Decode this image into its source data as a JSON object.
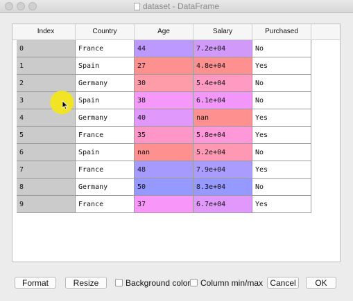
{
  "window": {
    "title": "dataset - DataFrame"
  },
  "table": {
    "headers": [
      "Index",
      "Country",
      "Age",
      "Salary",
      "Purchased"
    ],
    "rows": [
      {
        "index": "0",
        "country": "France",
        "age": "44",
        "salary": "7.2e+04",
        "purchased": "No",
        "age_color": "#bb99ff",
        "salary_color": "#d199fa"
      },
      {
        "index": "1",
        "country": "Spain",
        "age": "27",
        "salary": "4.8e+04",
        "purchased": "Yes",
        "age_color": "#ff9090",
        "salary_color": "#ff9090"
      },
      {
        "index": "2",
        "country": "Germany",
        "age": "30",
        "salary": "5.4e+04",
        "purchased": "No",
        "age_color": "#ff9caa",
        "salary_color": "#ff9ac2"
      },
      {
        "index": "3",
        "country": "Spain",
        "age": "38",
        "salary": "6.1e+04",
        "purchased": "No",
        "age_color": "#f598fa",
        "salary_color": "#f396fa"
      },
      {
        "index": "4",
        "country": "Germany",
        "age": "40",
        "salary": "nan",
        "purchased": "Yes",
        "age_color": "#e099fa",
        "salary_color": "#ff9090"
      },
      {
        "index": "5",
        "country": "France",
        "age": "35",
        "salary": "5.8e+04",
        "purchased": "Yes",
        "age_color": "#ff96c8",
        "salary_color": "#ff98d8"
      },
      {
        "index": "6",
        "country": "Spain",
        "age": "nan",
        "salary": "5.2e+04",
        "purchased": "No",
        "age_color": "#ff9090",
        "salary_color": "#ff98b2"
      },
      {
        "index": "7",
        "country": "France",
        "age": "48",
        "salary": "7.9e+04",
        "purchased": "Yes",
        "age_color": "#a699ff",
        "salary_color": "#a99bff"
      },
      {
        "index": "8",
        "country": "Germany",
        "age": "50",
        "salary": "8.3e+04",
        "purchased": "No",
        "age_color": "#9699ff",
        "salary_color": "#9699ff"
      },
      {
        "index": "9",
        "country": "France",
        "age": "37",
        "salary": "6.7e+04",
        "purchased": "Yes",
        "age_color": "#f896fa",
        "salary_color": "#e098fa"
      }
    ]
  },
  "footer": {
    "format_label": "Format",
    "resize_label": "Resize",
    "background_color_label": "Background color",
    "column_minmax_label": "Column min/max",
    "cancel_label": "Cancel",
    "ok_label": "OK"
  }
}
